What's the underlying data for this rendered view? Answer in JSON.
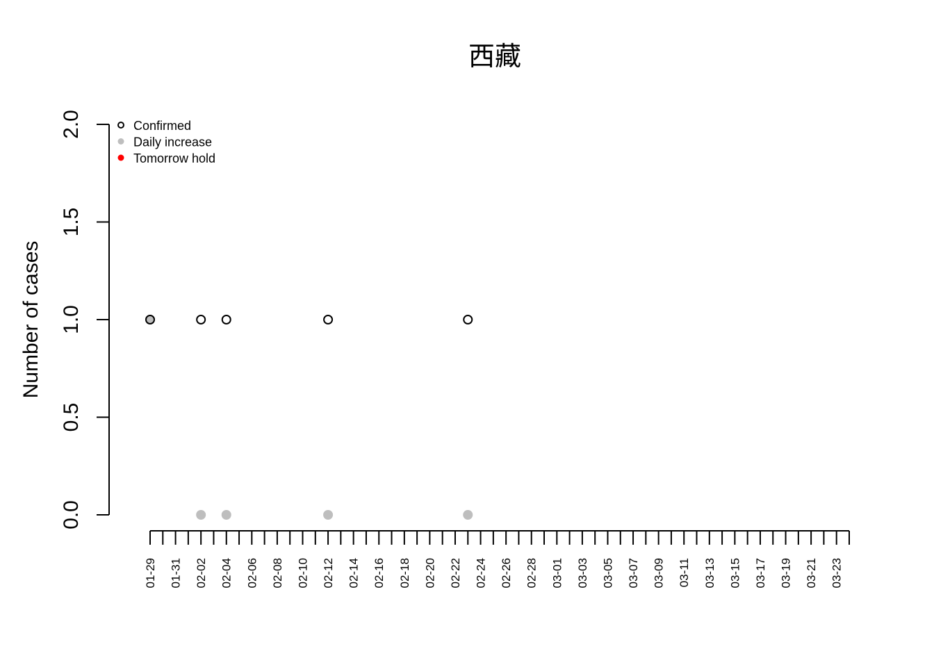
{
  "chart_data": {
    "type": "scatter",
    "title": "西藏",
    "xlabel": "",
    "ylabel": "Number of cases",
    "ylim": [
      0,
      2
    ],
    "yticks": [
      "0.0",
      "0.5",
      "1.0",
      "1.5",
      "2.0"
    ],
    "x_dates": [
      "01-29",
      "01-30",
      "01-31",
      "02-01",
      "02-02",
      "02-03",
      "02-04",
      "02-05",
      "02-06",
      "02-07",
      "02-08",
      "02-09",
      "02-10",
      "02-11",
      "02-12",
      "02-13",
      "02-14",
      "02-15",
      "02-16",
      "02-17",
      "02-18",
      "02-19",
      "02-20",
      "02-21",
      "02-22",
      "02-23",
      "02-24",
      "02-25",
      "02-26",
      "02-27",
      "02-28",
      "02-29",
      "03-01",
      "03-02",
      "03-03",
      "03-04",
      "03-05",
      "03-06",
      "03-07",
      "03-08",
      "03-09",
      "03-10",
      "03-11",
      "03-12",
      "03-13",
      "03-14",
      "03-15",
      "03-16",
      "03-17",
      "03-18",
      "03-19",
      "03-20",
      "03-21",
      "03-22",
      "03-23",
      "03-24"
    ],
    "xtick_labels": [
      "01-29",
      "01-31",
      "02-02",
      "02-04",
      "02-06",
      "02-08",
      "02-10",
      "02-12",
      "02-14",
      "02-16",
      "02-18",
      "02-20",
      "02-22",
      "02-24",
      "02-26",
      "02-28",
      "03-01",
      "03-03",
      "03-05",
      "03-07",
      "03-09",
      "03-11",
      "03-13",
      "03-15",
      "03-17",
      "03-19",
      "03-21",
      "03-23"
    ],
    "grid": false,
    "legend_position": "top-left",
    "series": [
      {
        "name": "Confirmed",
        "marker": "open-circle",
        "color": "#000000",
        "x": [
          "01-29",
          "02-02",
          "02-04",
          "02-12",
          "02-23"
        ],
        "y": [
          1,
          1,
          1,
          1,
          1
        ]
      },
      {
        "name": "Daily increase",
        "marker": "filled-circle",
        "color": "#bebebe",
        "x": [
          "01-29",
          "02-02",
          "02-04",
          "02-12",
          "02-23"
        ],
        "y": [
          1,
          0,
          0,
          0,
          0
        ]
      },
      {
        "name": "Tomorrow hold",
        "marker": "filled-circle",
        "color": "#ff0000",
        "x": [],
        "y": []
      }
    ]
  }
}
